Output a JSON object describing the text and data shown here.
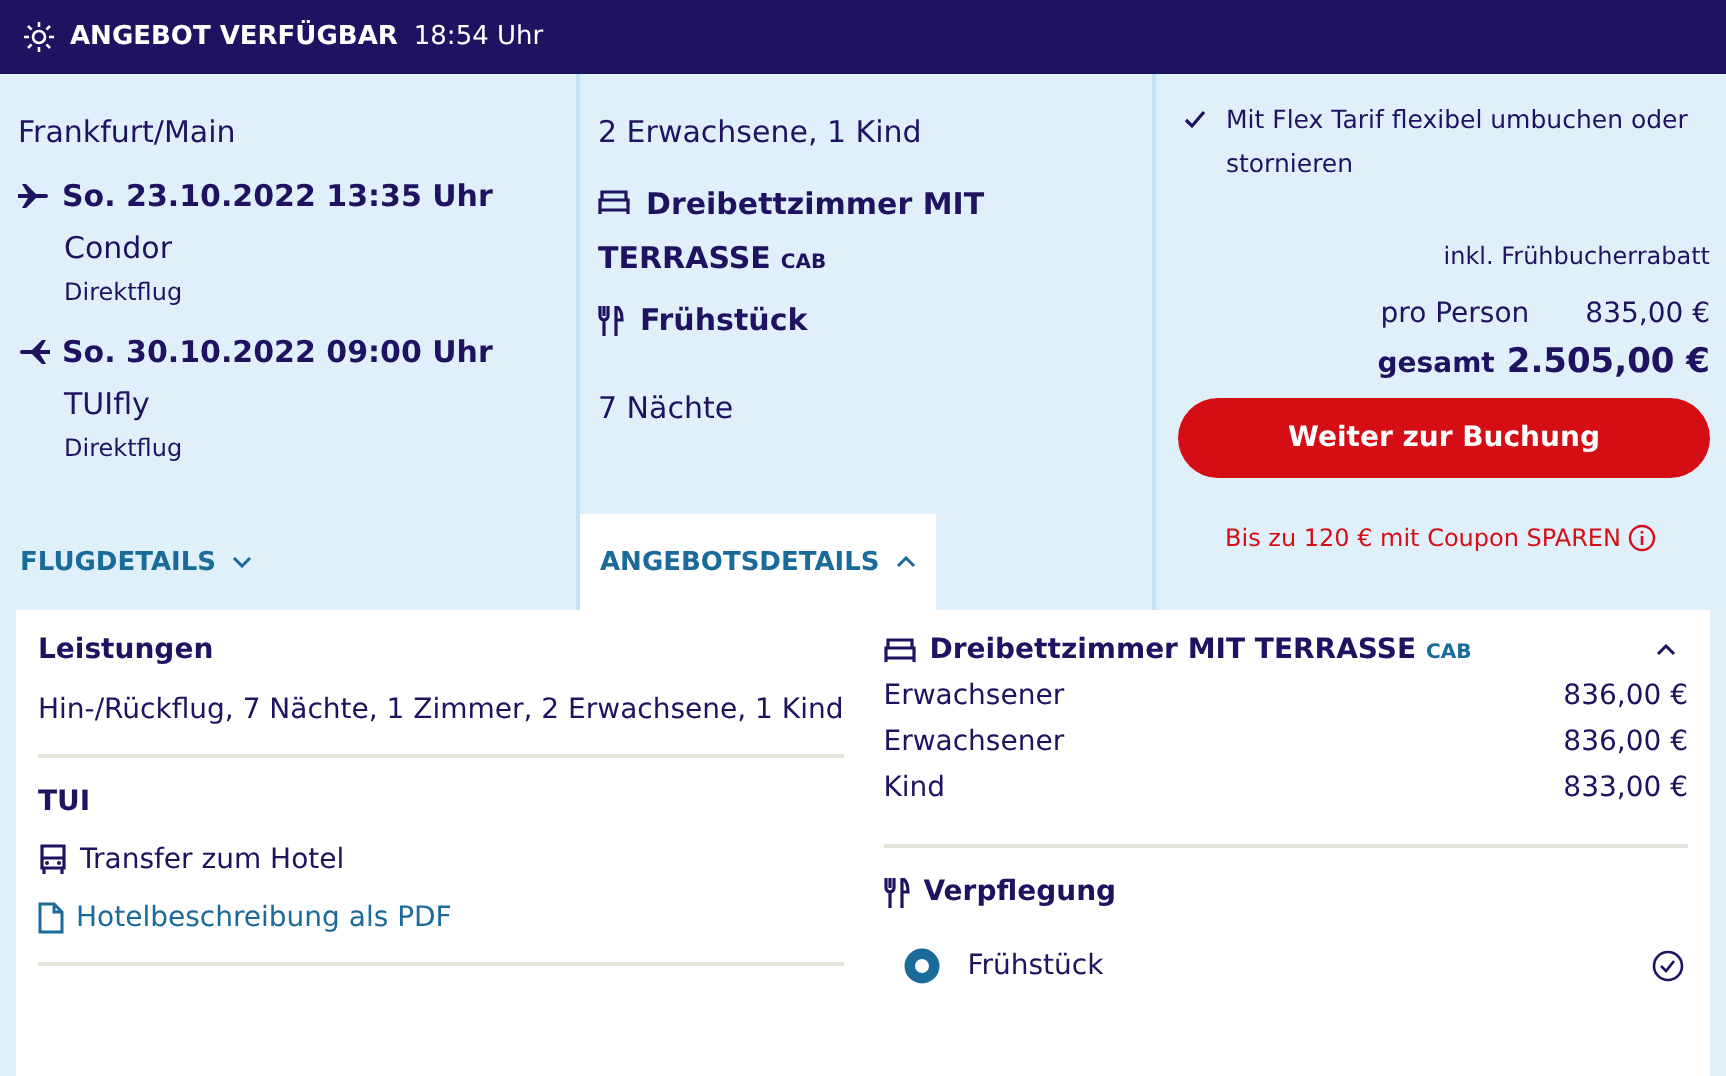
{
  "header": {
    "title": "ANGEBOT VERFÜGBAR",
    "time": "18:54 Uhr"
  },
  "flight": {
    "origin": "Frankfurt/Main",
    "legs": [
      {
        "kind": "outbound",
        "date": "So. 23.10.2022 13:35 Uhr",
        "airline": "Condor",
        "type": "Direktflug"
      },
      {
        "kind": "return",
        "date": "So. 30.10.2022 09:00 Uhr",
        "airline": "TUIfly",
        "type": "Direktflug"
      }
    ]
  },
  "offer": {
    "travellers": "2 Erwachsene, 1 Kind",
    "room": {
      "name": "Dreibettzimmer MIT TERRASSE",
      "code": "CAB"
    },
    "board": "Frühstück",
    "nights": "7 Nächte"
  },
  "tabs": [
    {
      "label": "FLUGDETAILS",
      "selected": false
    },
    {
      "label": "ANGEBOTSDETAILS",
      "selected": true
    }
  ],
  "price": {
    "flex_note": "Mit Flex Tarif flexibel umbuchen oder stornieren",
    "discount_note": "inkl. Frühbucherrabatt",
    "per_person_label": "pro Person",
    "per_person": "835,00 €",
    "total_label": "gesamt",
    "total": "2.505,00 €",
    "button": "Weiter zur Buchung",
    "coupon": "Bis zu 120 € mit Coupon SPAREN"
  },
  "details": {
    "services": {
      "title": "Leistungen",
      "text": "Hin-/Rückflug, 7 Nächte, 1 Zimmer, 2 Erwachsene, 1 Kind"
    },
    "provider": {
      "title": "TUI",
      "items": [
        {
          "kind": "transfer",
          "label": "Transfer zum Hotel"
        },
        {
          "kind": "pdf",
          "label": "Hotelbeschreibung als PDF"
        }
      ]
    },
    "room": {
      "name": "Dreibettzimmer MIT TERRASSE",
      "code": "CAB",
      "expanded": true,
      "rows": [
        {
          "label": "Erwachsener",
          "price": "836,00 €"
        },
        {
          "label": "Erwachsener",
          "price": "836,00 €"
        },
        {
          "label": "Kind",
          "price": "833,00 €"
        }
      ]
    },
    "board": {
      "title": "Verpflegung",
      "options": [
        {
          "label": "Frühstück",
          "selected": true
        }
      ]
    }
  }
}
